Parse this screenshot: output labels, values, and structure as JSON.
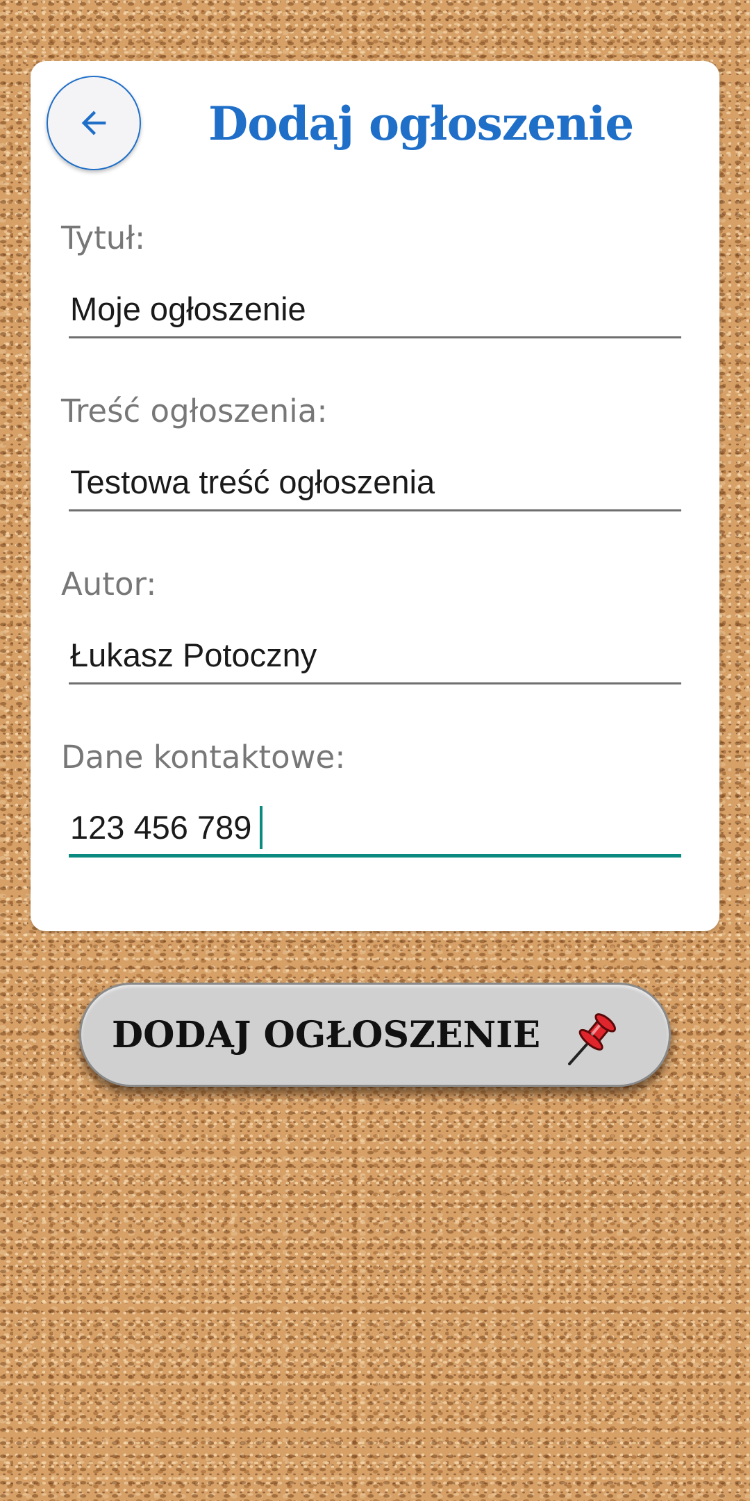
{
  "header": {
    "title": "Dodaj ogłoszenie",
    "back_icon": "arrow-left-icon"
  },
  "form": {
    "fields": [
      {
        "label": "Tytuł:",
        "value": "Moje ogłoszenie"
      },
      {
        "label": "Treść ogłoszenia:",
        "value": "Testowa treść ogłoszenia"
      },
      {
        "label": "Autor:",
        "value": "Łukasz Potoczny"
      },
      {
        "label": "Dane kontaktowe:",
        "value": "123 456 789"
      }
    ]
  },
  "submit": {
    "label": "DODAJ OGŁOSZENIE",
    "icon": "pushpin-icon"
  },
  "colors": {
    "accent": "#1f6fc9",
    "active_underline": "#0b8a7f",
    "pin": "#e0252c"
  }
}
